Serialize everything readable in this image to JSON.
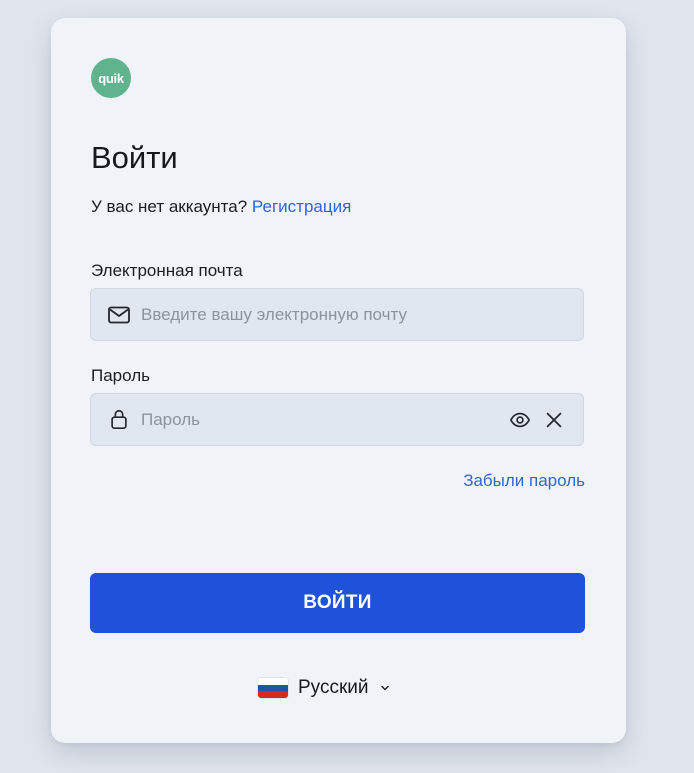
{
  "brand": {
    "logo_text": "quik",
    "logo_color": "#5fb38d"
  },
  "login": {
    "title": "Войти",
    "no_account_text": "У вас нет аккаунта?",
    "signup_link": "Регистрация",
    "email": {
      "label": "Электронная почта",
      "placeholder": "Введите вашу электронную почту",
      "value": "",
      "icon": "envelope-icon"
    },
    "password": {
      "label": "Пароль",
      "placeholder": "Пароль",
      "value": "",
      "icon": "lock-icon",
      "show_icon": "eye-icon",
      "clear_icon": "close-icon"
    },
    "forgot_link": "Забыли пароль",
    "submit_label": "ВОЙТИ"
  },
  "language": {
    "selected": "Русский",
    "flag": "russia-flag-icon",
    "flag_colors": [
      "#ffffff",
      "#1c57a5",
      "#d52b1e"
    ]
  },
  "colors": {
    "accent": "#1f52d8",
    "link": "#2f65d8",
    "card": "#f0f3f8",
    "background": "#e1e6ee"
  }
}
